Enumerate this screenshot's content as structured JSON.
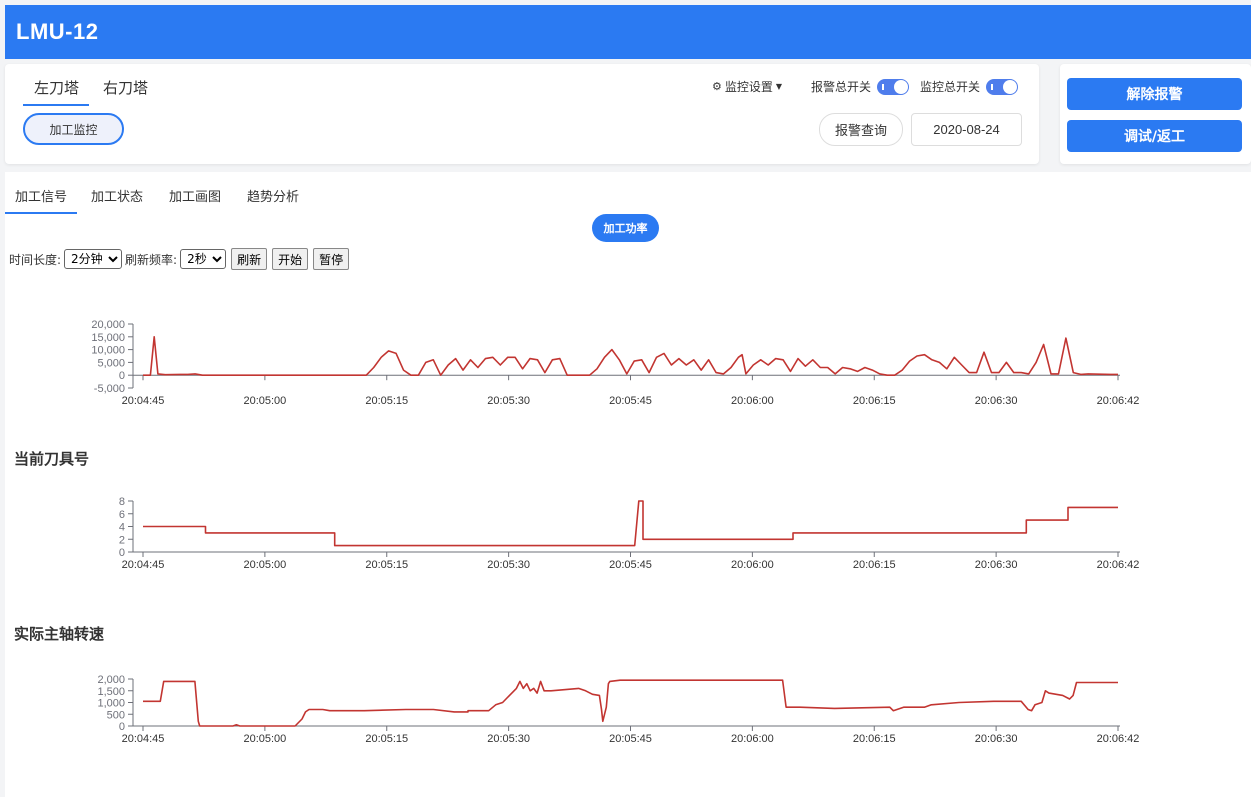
{
  "app": {
    "title": "LMU-12"
  },
  "turret_tabs": [
    "左刀塔",
    "右刀塔"
  ],
  "monitor_button": "加工监控",
  "header": {
    "monitor_settings": "监控设置",
    "alarm_switch_label": "报警总开关",
    "monitor_switch_label": "监控总开关",
    "alarm_query": "报警查询",
    "date": "2020-08-24"
  },
  "actions": {
    "clear_alarm": "解除报警",
    "debug_rework": "调试/返工"
  },
  "sub_tabs": [
    "加工信号",
    "加工状态",
    "加工画图",
    "趋势分析"
  ],
  "power_button": "加工功率",
  "controls": {
    "duration_label": "时间长度:",
    "duration_value": "2分钟",
    "refresh_label": "刷新频率:",
    "refresh_value": "2秒",
    "refresh_btn": "刷新",
    "start_btn": "开始",
    "pause_btn": "暂停"
  },
  "colors": {
    "brand": "#2b7af2",
    "series": "#c23531"
  },
  "chart_data": [
    {
      "type": "line",
      "title": "",
      "x_labels": [
        "20:04:45",
        "20:05:00",
        "20:05:15",
        "20:05:30",
        "20:05:45",
        "20:06:00",
        "20:06:15",
        "20:06:30",
        "20:06:42"
      ],
      "x_range": [
        0,
        117
      ],
      "ylim": [
        -5000,
        20000
      ],
      "y_ticks": [
        "-5,000",
        "0",
        "5,000",
        "10,000",
        "15,000",
        "20,000"
      ],
      "y_tick_values": [
        -5000,
        0,
        5000,
        10000,
        15000,
        20000
      ],
      "series": [
        {
          "name": "",
          "points": [
            [
              0,
              0
            ],
            [
              1,
              0
            ],
            [
              1.5,
              15000
            ],
            [
              2,
              500
            ],
            [
              3,
              200
            ],
            [
              5,
              300
            ],
            [
              6,
              300
            ],
            [
              7,
              500
            ],
            [
              8,
              0
            ],
            [
              15,
              0
            ],
            [
              22,
              0
            ],
            [
              30,
              0
            ],
            [
              31,
              3000
            ],
            [
              32,
              7000
            ],
            [
              33,
              9500
            ],
            [
              34,
              8500
            ],
            [
              35,
              2000
            ],
            [
              36,
              0
            ],
            [
              37,
              0
            ],
            [
              38,
              5000
            ],
            [
              39,
              6000
            ],
            [
              40,
              0
            ],
            [
              41,
              4000
            ],
            [
              42,
              6500
            ],
            [
              43,
              2000
            ],
            [
              44,
              6000
            ],
            [
              45,
              3000
            ],
            [
              46,
              6500
            ],
            [
              47,
              7000
            ],
            [
              48,
              4000
            ],
            [
              49,
              7000
            ],
            [
              50,
              7000
            ],
            [
              51,
              2500
            ],
            [
              52,
              6500
            ],
            [
              53,
              6000
            ],
            [
              54,
              1000
            ],
            [
              55,
              6000
            ],
            [
              56,
              6500
            ],
            [
              57,
              0
            ],
            [
              60,
              0
            ],
            [
              61,
              2500
            ],
            [
              62,
              7000
            ],
            [
              63,
              10000
            ],
            [
              64,
              6000
            ],
            [
              65,
              500
            ],
            [
              66,
              5500
            ],
            [
              67,
              6000
            ],
            [
              68,
              1000
            ],
            [
              69,
              7000
            ],
            [
              70,
              8500
            ],
            [
              71,
              4000
            ],
            [
              72,
              6500
            ],
            [
              73,
              4000
            ],
            [
              74,
              6000
            ],
            [
              75,
              2000
            ],
            [
              76,
              6000
            ],
            [
              77,
              1000
            ],
            [
              78,
              500
            ],
            [
              79,
              3000
            ],
            [
              80,
              7000
            ],
            [
              80.5,
              8000
            ],
            [
              81,
              500
            ],
            [
              82,
              4000
            ],
            [
              83,
              6000
            ],
            [
              84,
              4000
            ],
            [
              85,
              6500
            ],
            [
              86,
              6000
            ],
            [
              87,
              1500
            ],
            [
              88,
              6500
            ],
            [
              89,
              3500
            ],
            [
              90,
              6000
            ],
            [
              91,
              3000
            ],
            [
              92,
              3000
            ],
            [
              93,
              500
            ],
            [
              94,
              3000
            ],
            [
              95,
              2500
            ],
            [
              96,
              1500
            ],
            [
              97,
              3000
            ],
            [
              98,
              2000
            ],
            [
              99,
              500
            ],
            [
              100,
              0
            ],
            [
              101,
              0
            ],
            [
              102,
              2000
            ],
            [
              103,
              5500
            ],
            [
              104,
              7500
            ],
            [
              105,
              8000
            ],
            [
              106,
              6000
            ],
            [
              107,
              5000
            ],
            [
              108,
              2500
            ],
            [
              109,
              7000
            ],
            [
              110,
              4000
            ],
            [
              111,
              1000
            ],
            [
              112,
              1000
            ],
            [
              113,
              9000
            ],
            [
              114,
              1000
            ],
            [
              115,
              1000
            ],
            [
              116,
              5000
            ],
            [
              117,
              1000
            ],
            [
              118,
              1000
            ],
            [
              119,
              500
            ],
            [
              120,
              5000
            ],
            [
              121,
              12000
            ],
            [
              122,
              500
            ],
            [
              123,
              500
            ],
            [
              124,
              14500
            ],
            [
              125,
              1000
            ],
            [
              126,
              300
            ],
            [
              127,
              500
            ],
            [
              130,
              300
            ],
            [
              131,
              300
            ]
          ]
        }
      ]
    },
    {
      "type": "line",
      "title": "当前刀具号",
      "x_labels": [
        "20:04:45",
        "20:05:00",
        "20:05:15",
        "20:05:30",
        "20:05:45",
        "20:06:00",
        "20:06:15",
        "20:06:30",
        "20:06:42"
      ],
      "x_range": [
        0,
        117
      ],
      "ylim": [
        0,
        8
      ],
      "y_ticks": [
        "0",
        "2",
        "4",
        "6",
        "8"
      ],
      "y_tick_values": [
        0,
        2,
        4,
        6,
        8
      ],
      "series": [
        {
          "name": "",
          "points": [
            [
              0,
              4
            ],
            [
              7.5,
              4
            ],
            [
              7.5,
              3
            ],
            [
              23,
              3
            ],
            [
              23,
              1
            ],
            [
              59,
              1
            ],
            [
              59.5,
              8
            ],
            [
              60,
              8
            ],
            [
              60,
              2
            ],
            [
              78,
              2
            ],
            [
              78,
              3
            ],
            [
              106,
              3
            ],
            [
              106,
              5
            ],
            [
              111,
              5
            ],
            [
              111,
              7
            ],
            [
              117,
              7
            ]
          ]
        }
      ]
    },
    {
      "type": "line",
      "title": "实际主轴转速",
      "x_labels": [
        "20:04:45",
        "20:05:00",
        "20:05:15",
        "20:05:30",
        "20:05:45",
        "20:06:00",
        "20:06:15",
        "20:06:30",
        "20:06:42"
      ],
      "x_range": [
        0,
        117
      ],
      "ylim": [
        0,
        2000
      ],
      "y_ticks": [
        "0",
        "500",
        "1,000",
        "1,500",
        "2,000"
      ],
      "y_tick_values": [
        0,
        500,
        1000,
        1500,
        2000
      ],
      "series": [
        {
          "name": "",
          "points": [
            [
              0,
              1050
            ],
            [
              2.5,
              1050
            ],
            [
              3,
              1900
            ],
            [
              7,
              1900
            ],
            [
              7.5,
              1900
            ],
            [
              8,
              200
            ],
            [
              8.2,
              0
            ],
            [
              13,
              0
            ],
            [
              13.5,
              50
            ],
            [
              14,
              0
            ],
            [
              22,
              0
            ],
            [
              23,
              300
            ],
            [
              23.5,
              600
            ],
            [
              24,
              700
            ],
            [
              26,
              700
            ],
            [
              27,
              650
            ],
            [
              32,
              650
            ],
            [
              38,
              700
            ],
            [
              42,
              700
            ],
            [
              45,
              600
            ],
            [
              47,
              600
            ],
            [
              47,
              650
            ],
            [
              50,
              650
            ],
            [
              51,
              900
            ],
            [
              52,
              1000
            ],
            [
              53,
              1300
            ],
            [
              54,
              1600
            ],
            [
              54.5,
              1900
            ],
            [
              55,
              1600
            ],
            [
              55.5,
              1800
            ],
            [
              56,
              1500
            ],
            [
              56.5,
              1600
            ],
            [
              57,
              1400
            ],
            [
              57.5,
              1900
            ],
            [
              58,
              1500
            ],
            [
              59,
              1500
            ],
            [
              63,
              1600
            ],
            [
              64,
              1500
            ],
            [
              65,
              1350
            ],
            [
              66,
              1300
            ],
            [
              66.3,
              700
            ],
            [
              66.5,
              200
            ],
            [
              67,
              800
            ],
            [
              67.3,
              1800
            ],
            [
              67.5,
              1900
            ],
            [
              69,
              1950
            ],
            [
              85,
              1950
            ],
            [
              92.5,
              1950
            ],
            [
              93,
              800
            ],
            [
              95,
              800
            ],
            [
              100,
              750
            ],
            [
              108,
              800
            ],
            [
              108.5,
              650
            ],
            [
              110,
              800
            ],
            [
              113,
              800
            ],
            [
              114,
              900
            ],
            [
              118,
              1000
            ],
            [
              123,
              1050
            ],
            [
              127,
              1050
            ],
            [
              128,
              700
            ],
            [
              128.5,
              650
            ],
            [
              129,
              900
            ],
            [
              130,
              1000
            ],
            [
              130.5,
              1500
            ],
            [
              131,
              1400
            ],
            [
              133,
              1300
            ],
            [
              134,
              1150
            ],
            [
              134.5,
              1300
            ],
            [
              135,
              1850
            ],
            [
              141,
              1850
            ]
          ]
        }
      ]
    }
  ]
}
